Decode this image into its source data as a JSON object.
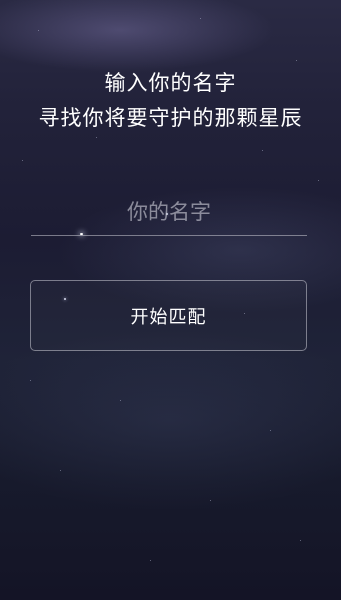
{
  "header": {
    "line1": "输入你的名字",
    "line2": "寻找你将要守护的那颗星辰"
  },
  "name_input": {
    "placeholder": "你的名字",
    "value": ""
  },
  "match_button": {
    "label": "开始匹配"
  },
  "colors": {
    "background_top": "#2a2a44",
    "background_bottom": "#141426",
    "text": "#ffffff",
    "border": "#c8c8d2"
  }
}
